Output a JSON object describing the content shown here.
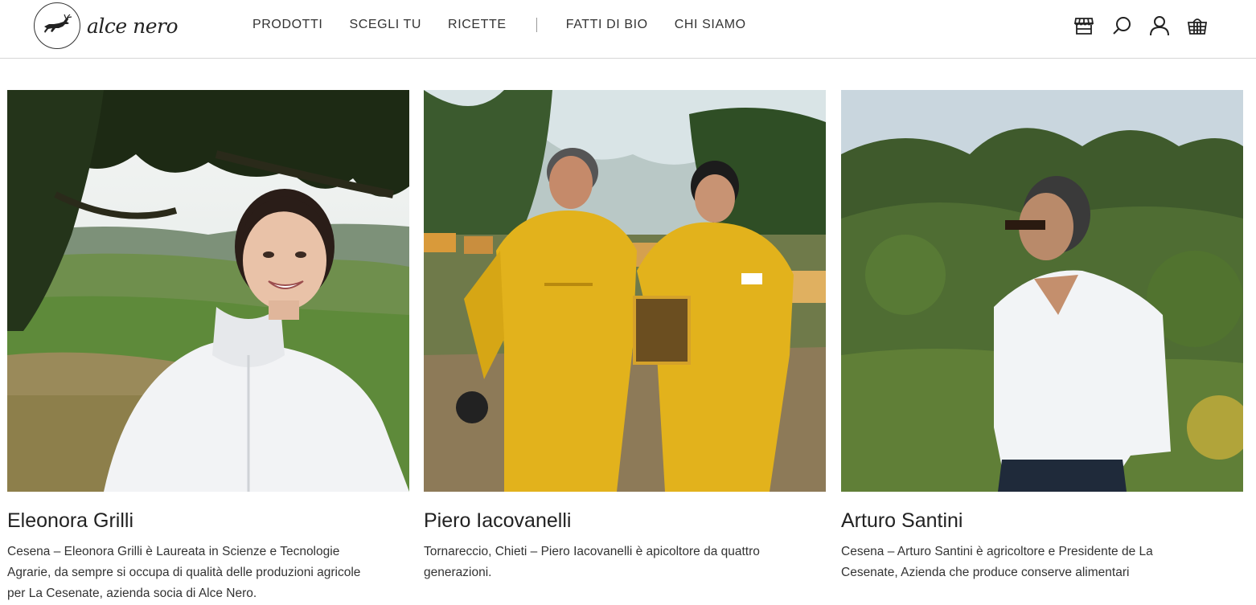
{
  "brand": {
    "name": "alce nero",
    "logo_icon": "reindeer-logo-icon"
  },
  "nav": {
    "items": [
      "PRODOTTI",
      "SCEGLI TU",
      "RICETTE"
    ],
    "items2": [
      "FATTI DI BIO",
      "CHI SIAMO"
    ]
  },
  "header_icons": [
    "store-icon",
    "search-icon",
    "user-icon",
    "basket-icon"
  ],
  "cards": [
    {
      "name": "Eleonora Grilli",
      "description": "Cesena – Eleonora Grilli è Laureata in Scienze e Tecnologie Agrarie, da sempre si occupa di qualità delle produzioni agricole per La Cesenate, azienda socia di Alce Nero."
    },
    {
      "name": "Piero Iacovanelli",
      "description": "Tornareccio, Chieti – Piero Iacovanelli è apicoltore da quattro generazioni."
    },
    {
      "name": "Arturo Santini",
      "description": "Cesena – Arturo Santini è agricoltore e Presidente de La Cesenate, Azienda che produce conserve alimentari"
    }
  ],
  "colors": {
    "text": "#222222",
    "header_border": "#d6d6d6",
    "beekeeper_suit": "#e2b21c"
  }
}
